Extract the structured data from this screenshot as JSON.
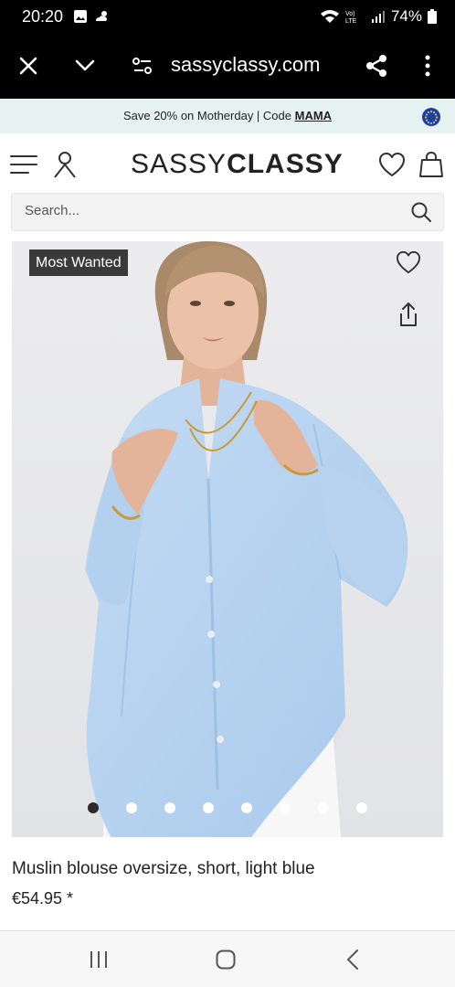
{
  "status": {
    "time": "20:20",
    "battery": "74%"
  },
  "browser": {
    "url": "sassyclassy.com"
  },
  "promo": {
    "text": "Save 20% on Motherday | Code ",
    "code": "MAMA"
  },
  "site": {
    "logo_light": "SASSY",
    "logo_bold": "CLASSY"
  },
  "search": {
    "placeholder": "Search..."
  },
  "product": {
    "badge": "Most Wanted",
    "title": "Muslin blouse oversize, short, light blue",
    "price": "€54.95 *",
    "image_count": 8,
    "active_image": 1
  },
  "colors": {
    "shirt": "#b7d4f0",
    "badge_bg": "#3a3a3a",
    "promo_bg": "#e6f2f1"
  }
}
